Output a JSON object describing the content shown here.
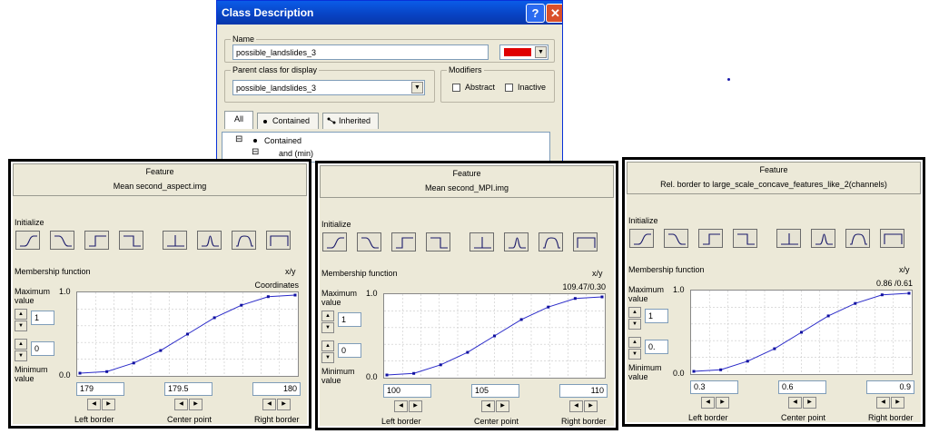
{
  "dialog": {
    "title": "Class Description",
    "help_glyph": "?",
    "close_glyph": "✕",
    "name_label": "Name",
    "name_value": "possible_landslides_3",
    "class_color": "#e00000",
    "parent_label": "Parent class for display",
    "parent_value": "possible_landslides_3",
    "modifiers_label": "Modifiers",
    "abstract_label": "Abstract",
    "inactive_label": "Inactive",
    "tabs": [
      {
        "label": "All",
        "icon": ""
      },
      {
        "label": "Contained",
        "icon": "bullet-icon"
      },
      {
        "label": "Inherited",
        "icon": "inherit-icon"
      }
    ],
    "tree": {
      "root_toggle": "⊟",
      "root_label": "Contained",
      "child_toggle": "⊟",
      "child_label": "and (min)"
    }
  },
  "panels": [
    {
      "feature_label": "Feature",
      "feature_name": "Mean second_aspect.img",
      "initialize_label": "Initialize",
      "membership_label": "Membership function",
      "xy_label": "x/y",
      "coordinates": "Coordinates",
      "max_label": "Maximum value",
      "min_label": "Minimum value",
      "max_value": "1",
      "min_value": "0",
      "y_top": "1.0",
      "y_bottom": "0.0",
      "left_border": "179",
      "center_point": "179.5",
      "right_border": "180",
      "left_border_label": "Left border",
      "center_point_label": "Center point",
      "right_border_label": "Right border"
    },
    {
      "feature_label": "Feature",
      "feature_name": "Mean second_MPI.img",
      "initialize_label": "Initialize",
      "membership_label": "Membership function",
      "xy_label": "x/y",
      "coordinates": "109.47/0.30",
      "max_label": "Maximum value",
      "min_label": "Minimum value",
      "max_value": "1",
      "min_value": "0",
      "y_top": "1.0",
      "y_bottom": "0.0",
      "left_border": "100",
      "center_point": "105",
      "right_border": "110",
      "left_border_label": "Left border",
      "center_point_label": "Center point",
      "right_border_label": "Right border"
    },
    {
      "feature_label": "Feature",
      "feature_name": "Rel. border to large_scale_concave_features_like_2(channels)",
      "initialize_label": "Initialize",
      "membership_label": "Membership function",
      "xy_label": "x/y",
      "coordinates": "0.86 /0.61",
      "max_label": "Maximum value",
      "min_label": "Minimum value",
      "max_value": "1",
      "min_value": "0.",
      "y_top": "1.0",
      "y_bottom": "0.0",
      "left_border": "0.3",
      "center_point": "0.6",
      "right_border": "0.9",
      "left_border_label": "Left border",
      "center_point_label": "Center point",
      "right_border_label": "Right border"
    }
  ],
  "membership_curve": {
    "x": [
      0,
      0.125,
      0.25,
      0.375,
      0.5,
      0.625,
      0.75,
      0.875,
      1
    ],
    "y": [
      0.0,
      0.02,
      0.13,
      0.29,
      0.5,
      0.71,
      0.87,
      0.98,
      1.0
    ],
    "color": "#2a2ac8"
  },
  "shape_buttons": [
    "larger-icon",
    "smaller-icon",
    "larger-step-icon",
    "smaller-step-icon",
    "singleton-icon",
    "approx-gaussian-icon",
    "approx-range-icon",
    "full-range-icon"
  ],
  "arrows": {
    "up": "▲",
    "down": "▼",
    "left": "◀",
    "right": "▶",
    "combo": "▼"
  }
}
